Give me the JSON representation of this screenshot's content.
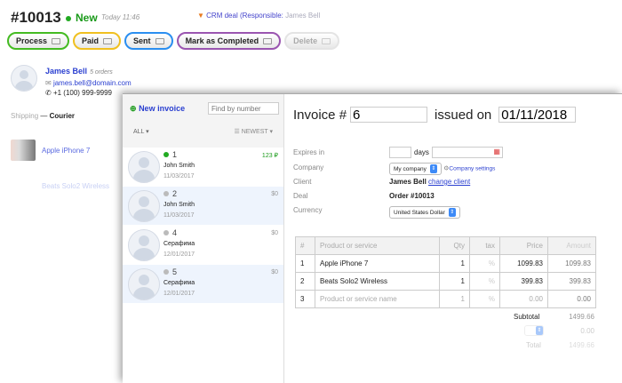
{
  "order": {
    "id": "#10013",
    "status": "New",
    "time": "Today 11:46",
    "crm_label": "CRM deal (Responsible:",
    "crm_person": "James Bell",
    "status_color": "#1a9a1a"
  },
  "actions": [
    {
      "label": "Process",
      "color": "#44bb22"
    },
    {
      "label": "Paid",
      "color": "#f0c020"
    },
    {
      "label": "Sent",
      "color": "#2a8ef0"
    },
    {
      "label": "Mark as Completed",
      "color": "#9a55b0"
    },
    {
      "label": "Delete",
      "color": "#ddd"
    }
  ],
  "customer": {
    "name": "James Bell",
    "orders": "5 orders",
    "email": "james.bell@domain.com",
    "phone": "+1 (100) 999-9999"
  },
  "shipping": {
    "label": "Shipping",
    "method": "Courier"
  },
  "products": [
    "Apple iPhone 7",
    "Beats Solo2 Wireless"
  ],
  "invoices": {
    "new_label": "New invoice",
    "search_placeholder": "Find by number",
    "filter": "ALL",
    "sort": "NEWEST",
    "items": [
      {
        "num": "1",
        "name": "John Smith",
        "date": "11/03/2017",
        "amount": "123 ₽",
        "paid": true
      },
      {
        "num": "2",
        "name": "John Smith",
        "date": "11/03/2017",
        "amount": "$0"
      },
      {
        "num": "4",
        "name": "Серафима",
        "date": "12/01/2017",
        "amount": "$0"
      },
      {
        "num": "5",
        "name": "Серафима",
        "date": "12/01/2017",
        "amount": "$0"
      }
    ]
  },
  "invoice": {
    "title": "Invoice #",
    "number": "6",
    "issued_label": "issued on",
    "date": "01/11/2018",
    "expires_label": "Expires in",
    "days_label": "days",
    "company_label": "Company",
    "company": "My company",
    "company_settings": "Company settings",
    "client_label": "Client",
    "client": "James Bell",
    "change_client": "change client",
    "deal_label": "Deal",
    "deal": "Order #10013",
    "currency_label": "Currency",
    "currency": "United States Dollar",
    "columns": [
      "#",
      "Product or service",
      "Qty",
      "tax",
      "Price",
      "Amount"
    ],
    "rows": [
      {
        "n": "1",
        "name": "Apple iPhone 7",
        "qty": "1",
        "tax": "%",
        "price": "1099.83",
        "amount": "1099.83"
      },
      {
        "n": "2",
        "name": "Beats Solo2 Wireless",
        "qty": "1",
        "tax": "%",
        "price": "399.83",
        "amount": "399.83"
      },
      {
        "n": "3",
        "name": "Product or service name",
        "qty": "1",
        "tax": "%",
        "price": "0.00",
        "amount": "0.00"
      }
    ],
    "subtotal_label": "Subtotal",
    "subtotal": "1499.66",
    "tax_amount": "0.00",
    "total_label": "Total",
    "total": "1499.66"
  }
}
